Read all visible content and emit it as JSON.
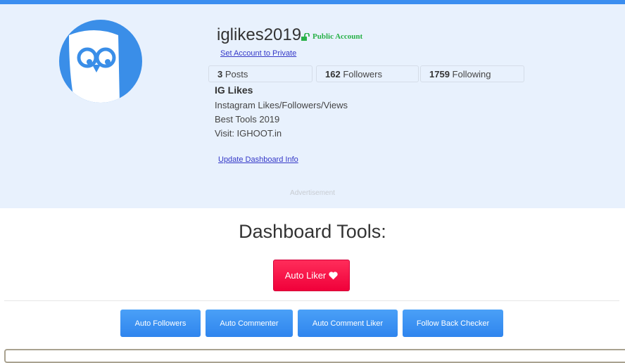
{
  "profile": {
    "username": "iglikes2019",
    "account_status": "Public Account",
    "set_private_link": "Set Account to Private",
    "stats": [
      {
        "count": "3",
        "label": "Posts"
      },
      {
        "count": "162",
        "label": "Followers"
      },
      {
        "count": "1759",
        "label": "Following"
      }
    ],
    "bio": {
      "name": "IG Likes",
      "lines": [
        "Instagram Likes/Followers/Views",
        "Best Tools 2019",
        "Visit: IGHOOT.in"
      ]
    },
    "update_link": "Update Dashboard Info",
    "advertisement": "Advertisement"
  },
  "dashboard": {
    "title": "Dashboard Tools:",
    "primary_button": "Auto Liker",
    "tools": [
      "Auto Followers",
      "Auto Commenter",
      "Auto Comment Liker",
      "Follow Back Checker"
    ]
  },
  "colors": {
    "accent": "#3b8ef0",
    "primary_red": "#f5003f",
    "public_green": "#28b148",
    "panel_bg": "#e8f1fd"
  }
}
